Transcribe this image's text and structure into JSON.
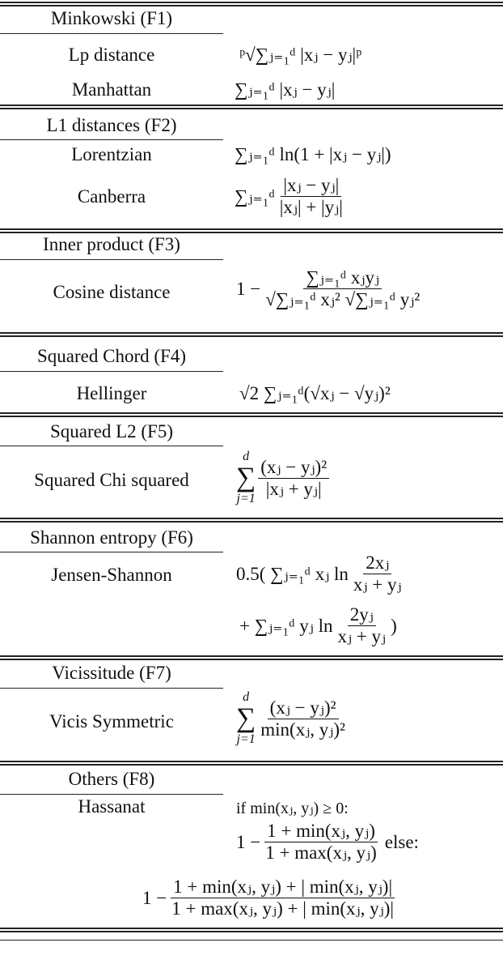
{
  "sections": [
    {
      "header": "Minkowski (F1)",
      "rows": [
        {
          "name": "Lp distance",
          "formula": "ᵖ√∑ⱼ₌₁ᵈ |xⱼ − yⱼ|ᵖ"
        },
        {
          "name": "Manhattan",
          "formula": "∑ⱼ₌₁ᵈ |xⱼ − yⱼ|"
        }
      ]
    },
    {
      "header": "L1 distances (F2)",
      "rows": [
        {
          "name": "Lorentzian",
          "formula": "∑ⱼ₌₁ᵈ ln(1 + |xⱼ − yⱼ|)"
        },
        {
          "name": "Canberra",
          "prefix": "∑ⱼ₌₁ᵈ",
          "num": "|xⱼ − yⱼ|",
          "den": "|xⱼ| + |yⱼ|"
        }
      ]
    },
    {
      "header": "Inner product (F3)",
      "rows": [
        {
          "name": "Cosine distance",
          "prefix": "1 −",
          "num": "∑ⱼ₌₁ᵈ xⱼyⱼ",
          "den": "√∑ⱼ₌₁ᵈ xⱼ² √∑ⱼ₌₁ᵈ yⱼ²"
        }
      ]
    },
    {
      "header": "Squared Chord (F4)",
      "rows": [
        {
          "name": "Hellinger",
          "formula": "√2 ∑ⱼ₌₁ᵈ(√xⱼ − √yⱼ)²"
        }
      ]
    },
    {
      "header": "Squared L2 (F5)",
      "rows": [
        {
          "name": "Squared Chi squared",
          "prefix": "∑",
          "sub": "j=1",
          "sup": "d",
          "num": "(xⱼ − yⱼ)²",
          "den": "|xⱼ + yⱼ|"
        }
      ]
    },
    {
      "header": "Shannon entropy (F6)",
      "rows": [
        {
          "name": "Jensen-Shannon",
          "line1_prefix": "0.5( ∑ⱼ₌₁ᵈ xⱼ ln",
          "line1_num": "2xⱼ",
          "line1_den": "xⱼ + yⱼ",
          "line2_prefix": "+ ∑ⱼ₌₁ᵈ yⱼ ln",
          "line2_num": "2yⱼ",
          "line2_den": "xⱼ + yⱼ",
          "line2_suffix": ")"
        }
      ]
    },
    {
      "header": "Vicissitude (F7)",
      "rows": [
        {
          "name": "Vicis Symmetric",
          "prefix": "∑",
          "sub": "j=1",
          "sup": "d",
          "num": "(xⱼ − yⱼ)²",
          "den": "min(xⱼ, yⱼ)²"
        }
      ]
    },
    {
      "header": "Others (F8)",
      "rows": [
        {
          "name": "Hassanat",
          "cond1": "if min(xⱼ, yⱼ) ≥ 0:",
          "prefix1": "1 −",
          "num1": "1 + min(xⱼ, yⱼ)",
          "den1": "1 + max(xⱼ, yⱼ)",
          "cond2": "else:",
          "prefix2": "1 −",
          "num2": "1 + min(xⱼ, yⱼ) + | min(xⱼ, yⱼ)|",
          "den2": "1 + max(xⱼ, yⱼ) + | min(xⱼ, yⱼ)|"
        }
      ]
    }
  ]
}
